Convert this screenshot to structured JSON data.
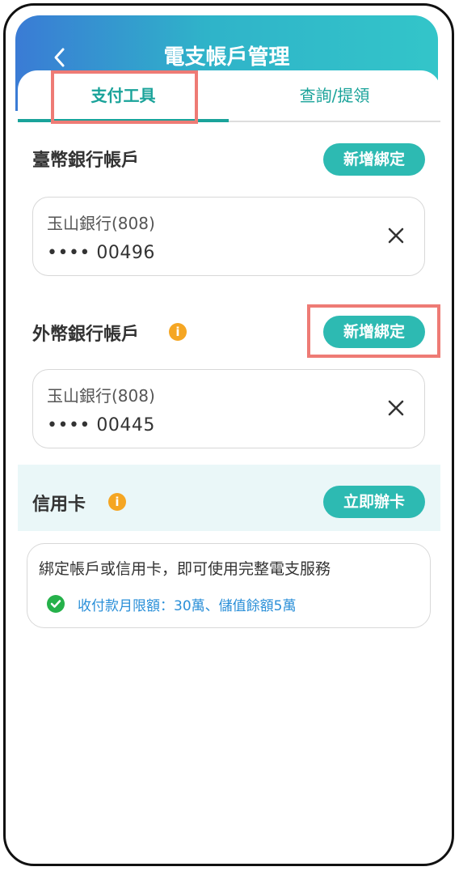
{
  "header": {
    "title": "電支帳戶管理",
    "back_icon": "chevron-left-icon"
  },
  "tabs": [
    {
      "label": "支付工具",
      "active": true
    },
    {
      "label": "查詢/提領",
      "active": false
    }
  ],
  "twd_section": {
    "title": "臺幣銀行帳戶",
    "add_label": "新增綁定",
    "account": {
      "bank": "玉山銀行(808)",
      "number": "•••• 00496"
    }
  },
  "fx_section": {
    "title": "外幣銀行帳戶",
    "add_label": "新增綁定",
    "info_icon": "info-icon",
    "account": {
      "bank": "玉山銀行(808)",
      "number": "•••• 00445"
    }
  },
  "credit_section": {
    "title": "信用卡",
    "apply_label": "立即辦卡",
    "info_icon": "info-icon"
  },
  "notice": {
    "text": "綁定帳戶或信用卡，即可使用完整電支服務",
    "limit_text": "收付款月限額：30萬、儲值餘額5萬"
  },
  "colors": {
    "accent": "#2dbab2",
    "header_start": "#3a7bd5",
    "header_end": "#33c5c9",
    "highlight": "#ee7b75",
    "info": "#f5a623",
    "success": "#25b14a",
    "link": "#2a8fd8"
  }
}
